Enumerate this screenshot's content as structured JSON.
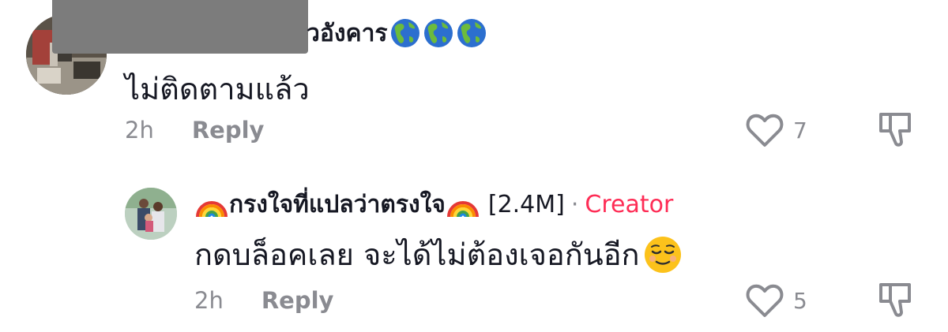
{
  "comments": [
    {
      "username_visible": "วอังคาร",
      "username_emoji": [
        "globe-americas-emoji",
        "globe-americas-emoji",
        "globe-americas-emoji"
      ],
      "text": "ไม่ติดตามแล้ว",
      "time": "2h",
      "reply_label": "Reply",
      "likes": "7"
    }
  ],
  "reply": {
    "username": "กรงใจที่แปลว่าตรงใจ",
    "followers": "[2.4M]",
    "separator": "·",
    "badge": "Creator",
    "text": "กดบล็อคเลย จะได้ไม่ต้องเจอกันอีก",
    "time": "2h",
    "reply_label": "Reply",
    "likes": "5"
  },
  "colors": {
    "text": "#161823",
    "muted": "#8a8b91",
    "creator": "#fe2c55",
    "redaction": "#7c7c7c"
  },
  "icons": [
    "heart-outline-icon",
    "dislike-icon",
    "rainbow-emoji",
    "relieved-face-emoji"
  ]
}
